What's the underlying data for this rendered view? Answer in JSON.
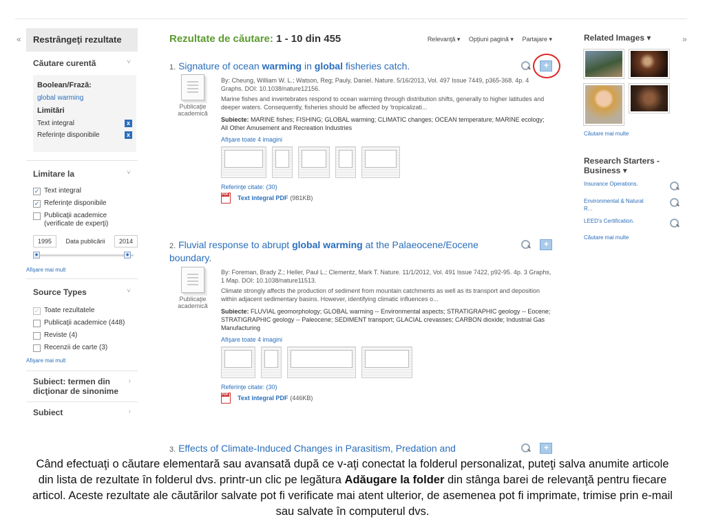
{
  "nav": {
    "collapse_left": "«",
    "collapse_right": "»"
  },
  "sidebar": {
    "header": "Restrângeţi rezultate",
    "current_search": {
      "title": "Căutare curentă",
      "boolean_label": "Boolean/Frază:",
      "query": "global warming",
      "limits_label": "Limitări",
      "limits": [
        "Text integral",
        "Referinţe disponibile"
      ]
    },
    "limit_to": {
      "title": "Limitare la",
      "options": [
        {
          "label": "Text integral",
          "checked": true
        },
        {
          "label": "Referinţe disponibile",
          "checked": true
        },
        {
          "label": "Publicaţii academice (verificate de experţi)",
          "checked": false
        }
      ],
      "date_from": "1995",
      "date_label": "Data publicării",
      "date_to": "2014",
      "show_more": "Afişare mai mult"
    },
    "source_types": {
      "title": "Source Types",
      "options": [
        {
          "label": "Toate rezultatele",
          "checked": true
        },
        {
          "label": "Publicaţii academice (448)",
          "checked": false
        },
        {
          "label": "Reviste (4)",
          "checked": false
        },
        {
          "label": "Recenzii de carte (3)",
          "checked": false
        }
      ],
      "show_more": "Afişare mai mult"
    },
    "thesaurus_title": "Subiect: termen din dicţionar de sinonime",
    "subject_title": "Subiect"
  },
  "results_header": {
    "label": "Rezultate de căutare:",
    "range": "1 - 10 din 455",
    "sort": "Relevanţă ▾",
    "page_options": "Opţiuni pagină ▾",
    "share": "Partajare ▾"
  },
  "results": [
    {
      "num": "1.",
      "title_parts": [
        "Signature of ocean ",
        "warming",
        " in ",
        "global",
        " fisheries catch."
      ],
      "doc_type": "Publicaţie academică",
      "meta": "By: Cheung, William W. L.; Watson, Reg; Pauly, Daniel. Nature. 5/16/2013, Vol. 497 Issue 7449, p365-368. 4p. 4 Graphs. DOI: 10.1038/nature12156.",
      "abstract": "Marine fishes and invertebrates respond to ocean warming through distribution shifts, generally to higher latitudes and deeper waters. Consequently, fisheries should be affected by 'tropicalizati...",
      "subjects_label": "Subiecte:",
      "subjects": "MARINE fishes; FISHING; GLOBAL warming; CLIMATIC changes; OCEAN temperature; MARINE ecology; All Other Amusement and Recreation Industries",
      "show_images": "Afişare toate 4 imagini",
      "cited": "Referinţe citate: (30)",
      "pdf_label": "Text integral PDF",
      "pdf_size": "(981KB)"
    },
    {
      "num": "2.",
      "title_parts": [
        "Fluvial response to abrupt ",
        "global warming",
        " at the Palaeocene/Eocene boundary."
      ],
      "doc_type": "Publicaţie academică",
      "meta": "By: Foreman, Brady Z.; Heller, Paul L.; Clementz, Mark T. Nature. 11/1/2012, Vol. 491 Issue 7422, p92-95. 4p. 3 Graphs, 1 Map. DOI: 10.1038/nature11513.",
      "abstract": "Climate strongly affects the production of sediment from mountain catchments as well as its transport and deposition within adjacent sedimentary basins. However, identifying climatic influences o...",
      "subjects_label": "Subiecte:",
      "subjects": "FLUVIAL geomorphology; GLOBAL warming -- Environmental aspects; STRATIGRAPHIC geology -- Eocene; STRATIGRAPHIC geology -- Paleocene; SEDIMENT transport; GLACIAL crevasses; CARBON dioxide; Industrial Gas Manufacturing",
      "show_images": "Afişare toate 4 imagini",
      "cited": "Referinţe citate: (30)",
      "pdf_label": "Text integral PDF",
      "pdf_size": "(446KB)"
    },
    {
      "num": "3.",
      "title_parts": [
        "Effects of Climate-Induced Changes in Parasitism, Predation and"
      ]
    }
  ],
  "right_sidebar": {
    "related_images": "Related Images ▾",
    "images_more": "Căutare mai multe",
    "research_title": "Research Starters - Business ▾",
    "research_items": [
      "Insurance Operations.",
      "Environmental & Natural R...",
      "LEED's Certification."
    ],
    "research_more": "Căutare mai multe"
  },
  "caption": {
    "part1": "Când efectuaţi o căutare elementară sau avansată după ce v-aţi conectat la folderul personalizat, puteţi salva anumite articole din lista de rezultate în folderul dvs. printr-un clic pe legătura ",
    "bold": "Adăugare la folder",
    "part2": " din stânga barei de relevanţă pentru fiecare articol. Aceste rezultate ale căutărilor salvate pot fi verificate mai atent ulterior, de asemenea pot fi imprimate, trimise prin e-mail sau salvate în computerul dvs."
  }
}
